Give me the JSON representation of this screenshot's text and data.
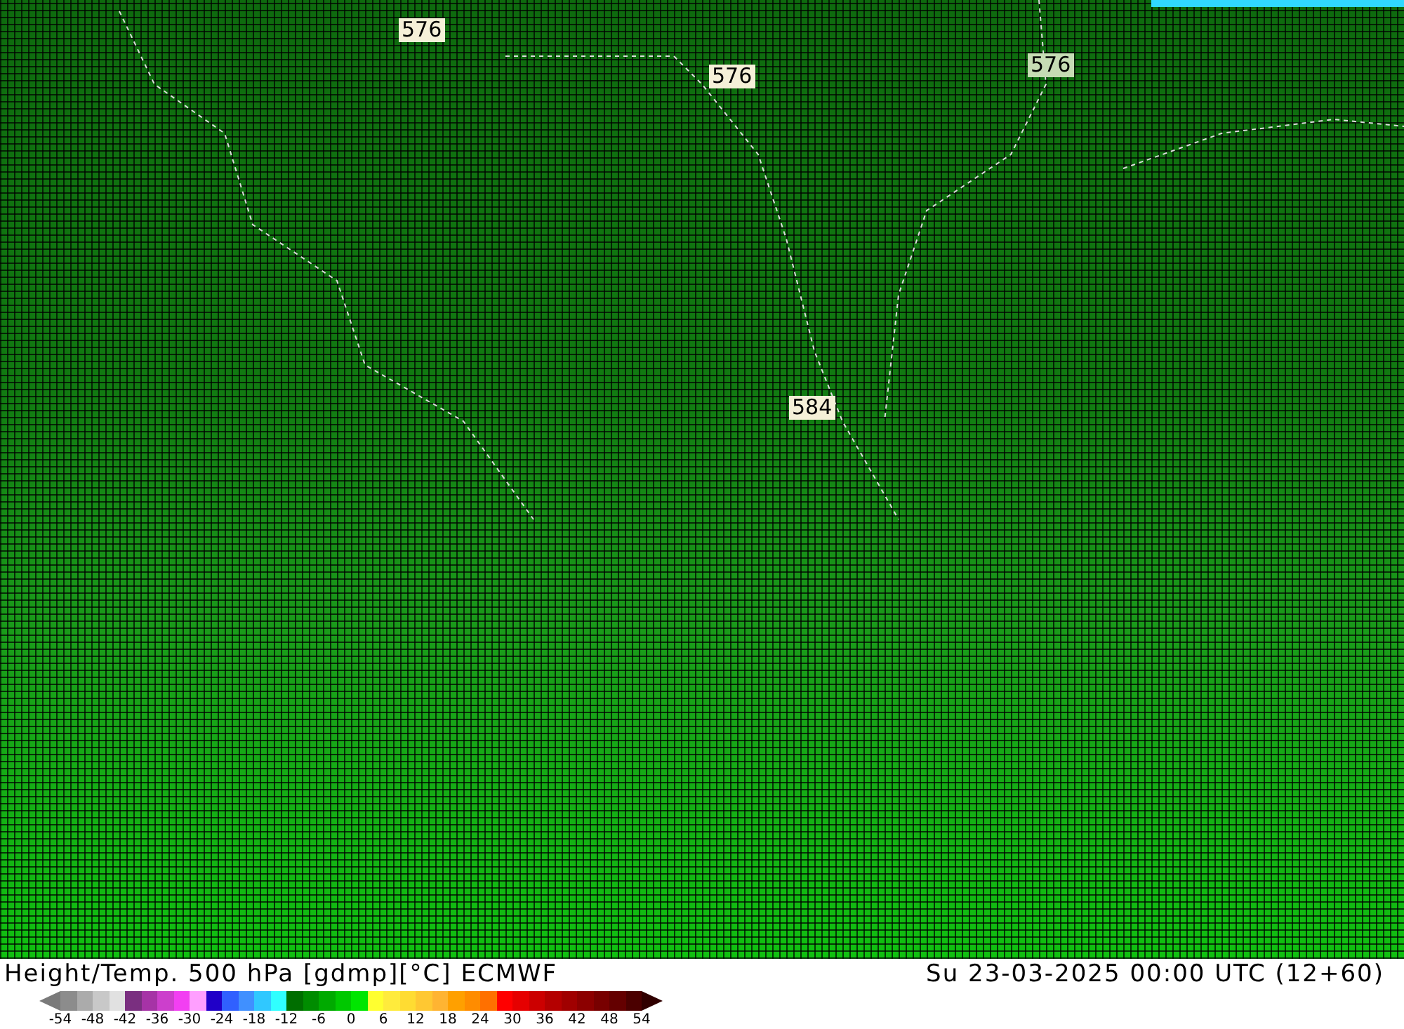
{
  "map": {
    "contour_labels": [
      {
        "text": "576",
        "kind": "plain"
      },
      {
        "text": "576",
        "kind": "plain"
      },
      {
        "text": "576",
        "kind": "faded"
      },
      {
        "text": "584",
        "kind": "plain"
      }
    ]
  },
  "footer": {
    "title": "Height/Temp. 500 hPa [gdmp][°C] ECMWF",
    "valid_time": "Su 23-03-2025 00:00 UTC (12+60)"
  },
  "legend": {
    "swatches": [
      {
        "kind": "low_arrow",
        "color": "#7a7a7a"
      },
      {
        "kind": "bin",
        "color": "#8c8c8c"
      },
      {
        "kind": "bin",
        "color": "#ababab"
      },
      {
        "kind": "bin",
        "color": "#c8c8c8"
      },
      {
        "kind": "bin",
        "color": "#e1e1e1"
      },
      {
        "kind": "bin",
        "color": "#7a2f80"
      },
      {
        "kind": "bin",
        "color": "#a633a6"
      },
      {
        "kind": "bin",
        "color": "#cc3fcc"
      },
      {
        "kind": "bin",
        "color": "#f23ff2"
      },
      {
        "kind": "bin",
        "color": "#ff9fff"
      },
      {
        "kind": "bin",
        "color": "#2000c8"
      },
      {
        "kind": "bin",
        "color": "#3060ff"
      },
      {
        "kind": "bin",
        "color": "#4090ff"
      },
      {
        "kind": "bin",
        "color": "#30c8ff"
      },
      {
        "kind": "bin",
        "color": "#30ffff"
      },
      {
        "kind": "bin",
        "color": "#006e00"
      },
      {
        "kind": "bin",
        "color": "#008c00"
      },
      {
        "kind": "bin",
        "color": "#00aa00"
      },
      {
        "kind": "bin",
        "color": "#00c800"
      },
      {
        "kind": "bin",
        "color": "#00e600"
      },
      {
        "kind": "bin",
        "color": "#ffff30"
      },
      {
        "kind": "bin",
        "color": "#ffeb3c"
      },
      {
        "kind": "bin",
        "color": "#ffdc32"
      },
      {
        "kind": "bin",
        "color": "#ffc832"
      },
      {
        "kind": "bin",
        "color": "#ffb432"
      },
      {
        "kind": "bin",
        "color": "#ffa000"
      },
      {
        "kind": "bin",
        "color": "#ff8c00"
      },
      {
        "kind": "bin",
        "color": "#ff7000"
      },
      {
        "kind": "bin",
        "color": "#ff0000"
      },
      {
        "kind": "bin",
        "color": "#e60000"
      },
      {
        "kind": "bin",
        "color": "#cc0000"
      },
      {
        "kind": "bin",
        "color": "#b40000"
      },
      {
        "kind": "bin",
        "color": "#a00000"
      },
      {
        "kind": "bin",
        "color": "#8c0000"
      },
      {
        "kind": "bin",
        "color": "#780000"
      },
      {
        "kind": "bin",
        "color": "#640000"
      },
      {
        "kind": "bin",
        "color": "#4b0000"
      },
      {
        "kind": "high_arrow",
        "color": "#300000"
      }
    ],
    "ticks": [
      "-54",
      "-48",
      "-42",
      "-36",
      "-30",
      "-24",
      "-18",
      "-12",
      "-6",
      "0",
      "6",
      "12",
      "18",
      "24",
      "30",
      "36",
      "42",
      "48",
      "54"
    ]
  }
}
